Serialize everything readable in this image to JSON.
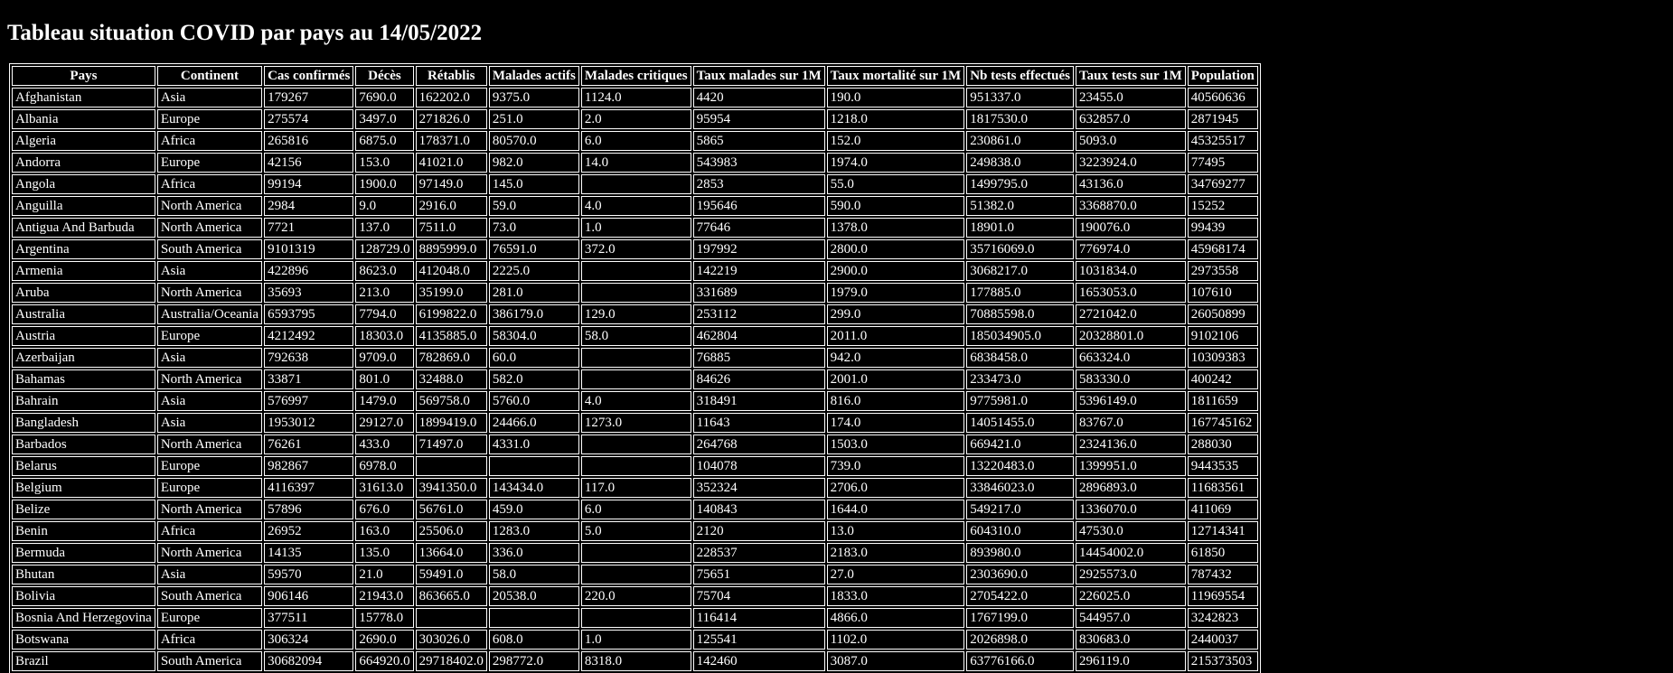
{
  "page": {
    "title": "Tableau situation COVID par pays au 14/05/2022"
  },
  "table": {
    "headers": [
      "Pays",
      "Continent",
      "Cas confirmés",
      "Décès",
      "Rétablis",
      "Malades actifs",
      "Malades critiques",
      "Taux malades sur 1M",
      "Taux mortalité sur 1M",
      "Nb tests effectués",
      "Taux tests sur 1M",
      "Population"
    ],
    "rows": [
      [
        "Afghanistan",
        "Asia",
        "179267",
        "7690.0",
        "162202.0",
        "9375.0",
        "1124.0",
        "4420",
        "190.0",
        "951337.0",
        "23455.0",
        "40560636"
      ],
      [
        "Albania",
        "Europe",
        "275574",
        "3497.0",
        "271826.0",
        "251.0",
        "2.0",
        "95954",
        "1218.0",
        "1817530.0",
        "632857.0",
        "2871945"
      ],
      [
        "Algeria",
        "Africa",
        "265816",
        "6875.0",
        "178371.0",
        "80570.0",
        "6.0",
        "5865",
        "152.0",
        "230861.0",
        "5093.0",
        "45325517"
      ],
      [
        "Andorra",
        "Europe",
        "42156",
        "153.0",
        "41021.0",
        "982.0",
        "14.0",
        "543983",
        "1974.0",
        "249838.0",
        "3223924.0",
        "77495"
      ],
      [
        "Angola",
        "Africa",
        "99194",
        "1900.0",
        "97149.0",
        "145.0",
        "",
        "2853",
        "55.0",
        "1499795.0",
        "43136.0",
        "34769277"
      ],
      [
        "Anguilla",
        "North America",
        "2984",
        "9.0",
        "2916.0",
        "59.0",
        "4.0",
        "195646",
        "590.0",
        "51382.0",
        "3368870.0",
        "15252"
      ],
      [
        "Antigua And Barbuda",
        "North America",
        "7721",
        "137.0",
        "7511.0",
        "73.0",
        "1.0",
        "77646",
        "1378.0",
        "18901.0",
        "190076.0",
        "99439"
      ],
      [
        "Argentina",
        "South America",
        "9101319",
        "128729.0",
        "8895999.0",
        "76591.0",
        "372.0",
        "197992",
        "2800.0",
        "35716069.0",
        "776974.0",
        "45968174"
      ],
      [
        "Armenia",
        "Asia",
        "422896",
        "8623.0",
        "412048.0",
        "2225.0",
        "",
        "142219",
        "2900.0",
        "3068217.0",
        "1031834.0",
        "2973558"
      ],
      [
        "Aruba",
        "North America",
        "35693",
        "213.0",
        "35199.0",
        "281.0",
        "",
        "331689",
        "1979.0",
        "177885.0",
        "1653053.0",
        "107610"
      ],
      [
        "Australia",
        "Australia/Oceania",
        "6593795",
        "7794.0",
        "6199822.0",
        "386179.0",
        "129.0",
        "253112",
        "299.0",
        "70885598.0",
        "2721042.0",
        "26050899"
      ],
      [
        "Austria",
        "Europe",
        "4212492",
        "18303.0",
        "4135885.0",
        "58304.0",
        "58.0",
        "462804",
        "2011.0",
        "185034905.0",
        "20328801.0",
        "9102106"
      ],
      [
        "Azerbaijan",
        "Asia",
        "792638",
        "9709.0",
        "782869.0",
        "60.0",
        "",
        "76885",
        "942.0",
        "6838458.0",
        "663324.0",
        "10309383"
      ],
      [
        "Bahamas",
        "North America",
        "33871",
        "801.0",
        "32488.0",
        "582.0",
        "",
        "84626",
        "2001.0",
        "233473.0",
        "583330.0",
        "400242"
      ],
      [
        "Bahrain",
        "Asia",
        "576997",
        "1479.0",
        "569758.0",
        "5760.0",
        "4.0",
        "318491",
        "816.0",
        "9775981.0",
        "5396149.0",
        "1811659"
      ],
      [
        "Bangladesh",
        "Asia",
        "1953012",
        "29127.0",
        "1899419.0",
        "24466.0",
        "1273.0",
        "11643",
        "174.0",
        "14051455.0",
        "83767.0",
        "167745162"
      ],
      [
        "Barbados",
        "North America",
        "76261",
        "433.0",
        "71497.0",
        "4331.0",
        "",
        "264768",
        "1503.0",
        "669421.0",
        "2324136.0",
        "288030"
      ],
      [
        "Belarus",
        "Europe",
        "982867",
        "6978.0",
        "",
        "",
        "",
        "104078",
        "739.0",
        "13220483.0",
        "1399951.0",
        "9443535"
      ],
      [
        "Belgium",
        "Europe",
        "4116397",
        "31613.0",
        "3941350.0",
        "143434.0",
        "117.0",
        "352324",
        "2706.0",
        "33846023.0",
        "2896893.0",
        "11683561"
      ],
      [
        "Belize",
        "North America",
        "57896",
        "676.0",
        "56761.0",
        "459.0",
        "6.0",
        "140843",
        "1644.0",
        "549217.0",
        "1336070.0",
        "411069"
      ],
      [
        "Benin",
        "Africa",
        "26952",
        "163.0",
        "25506.0",
        "1283.0",
        "5.0",
        "2120",
        "13.0",
        "604310.0",
        "47530.0",
        "12714341"
      ],
      [
        "Bermuda",
        "North America",
        "14135",
        "135.0",
        "13664.0",
        "336.0",
        "",
        "228537",
        "2183.0",
        "893980.0",
        "14454002.0",
        "61850"
      ],
      [
        "Bhutan",
        "Asia",
        "59570",
        "21.0",
        "59491.0",
        "58.0",
        "",
        "75651",
        "27.0",
        "2303690.0",
        "2925573.0",
        "787432"
      ],
      [
        "Bolivia",
        "South America",
        "906146",
        "21943.0",
        "863665.0",
        "20538.0",
        "220.0",
        "75704",
        "1833.0",
        "2705422.0",
        "226025.0",
        "11969554"
      ],
      [
        "Bosnia And Herzegovina",
        "Europe",
        "377511",
        "15778.0",
        "",
        "",
        "",
        "116414",
        "4866.0",
        "1767199.0",
        "544957.0",
        "3242823"
      ],
      [
        "Botswana",
        "Africa",
        "306324",
        "2690.0",
        "303026.0",
        "608.0",
        "1.0",
        "125541",
        "1102.0",
        "2026898.0",
        "830683.0",
        "2440037"
      ],
      [
        "Brazil",
        "South America",
        "30682094",
        "664920.0",
        "29718402.0",
        "298772.0",
        "8318.0",
        "142460",
        "3087.0",
        "63776166.0",
        "296119.0",
        "215373503"
      ]
    ]
  }
}
